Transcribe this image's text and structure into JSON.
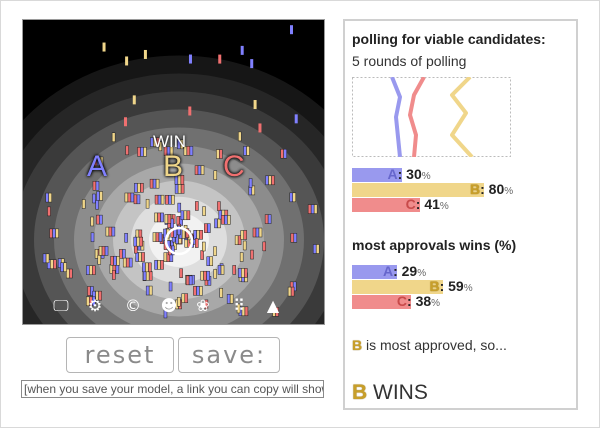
{
  "simulation": {
    "winner_tag": "WIN",
    "candidates": [
      {
        "letter": "A",
        "color": "#8080ff"
      },
      {
        "letter": "B",
        "color": "#f0d68a"
      },
      {
        "letter": "C",
        "color": "#f07070"
      }
    ],
    "toolbar": [
      {
        "name": "monitor-icon",
        "glyph": "🖵"
      },
      {
        "name": "gear-icon",
        "glyph": "⚙"
      },
      {
        "name": "copyright-icon",
        "glyph": "©"
      },
      {
        "name": "face-icon",
        "glyph": "☻"
      },
      {
        "name": "flower-icon",
        "glyph": "❀"
      },
      {
        "name": "grid-dots-icon",
        "glyph": "⠿"
      },
      {
        "name": "triangle-icon",
        "glyph": "▲"
      }
    ]
  },
  "controls": {
    "reset_label": "reset",
    "save_label": "save:",
    "save_output_placeholder": "[when you save your model, a link you can copy will show up here]"
  },
  "results": {
    "polling_title": "polling for viable candidates:",
    "polling_rounds": "5 rounds of polling",
    "polling": [
      {
        "letter": "A",
        "value": 30,
        "color": "#9999ee"
      },
      {
        "letter": "B",
        "value": 80,
        "color": "#f0d68a"
      },
      {
        "letter": "C",
        "value": 41,
        "color": "#f08c8c"
      }
    ],
    "approval_title": "most approvals wins (%)",
    "approvals": [
      {
        "letter": "A",
        "value": 29,
        "color": "#9999ee"
      },
      {
        "letter": "B",
        "value": 59,
        "color": "#f0d68a"
      },
      {
        "letter": "C",
        "value": 38,
        "color": "#f08c8c"
      }
    ],
    "most_approved_letter": "B",
    "most_approved_text": " is most approved, so...",
    "winner_letter": "B",
    "winner_text": " WINS",
    "pct_sign": "%"
  }
}
